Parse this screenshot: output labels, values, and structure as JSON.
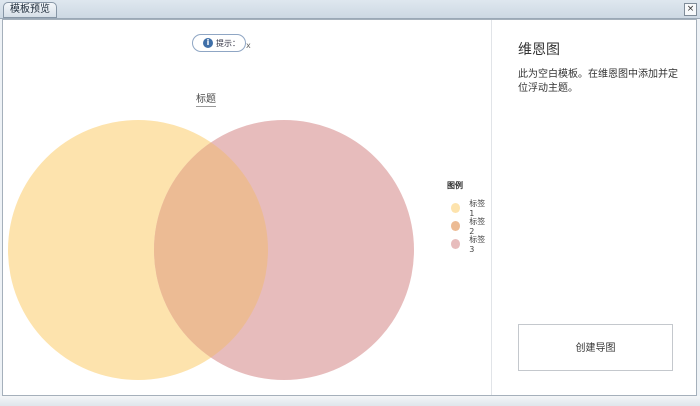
{
  "window": {
    "tab_title": "模板预览",
    "close_glyph": "×"
  },
  "preview": {
    "hint": {
      "label": "提示：",
      "close_glyph": "x"
    },
    "chart_title": "标题"
  },
  "chart_data": {
    "type": "venn",
    "title": "标题",
    "sets": [
      {
        "name": "标签 1",
        "color": "#fde3ad"
      },
      {
        "name": "标签 3",
        "color": "#e7bcbc"
      }
    ],
    "intersection": {
      "name": "标签 2",
      "color": "#ecbb94"
    },
    "legend": {
      "title": "图例",
      "position": "right",
      "items": [
        {
          "label": "标签 1",
          "color": "#fde3ad"
        },
        {
          "label": "标签 2",
          "color": "#ecbb94"
        },
        {
          "label": "标签 3",
          "color": "#e7bcbc"
        }
      ]
    }
  },
  "panel": {
    "heading": "维恩图",
    "description": "此为空白模板。在维恩图中添加并定位浮动主题。",
    "create_button": "创建导图"
  }
}
